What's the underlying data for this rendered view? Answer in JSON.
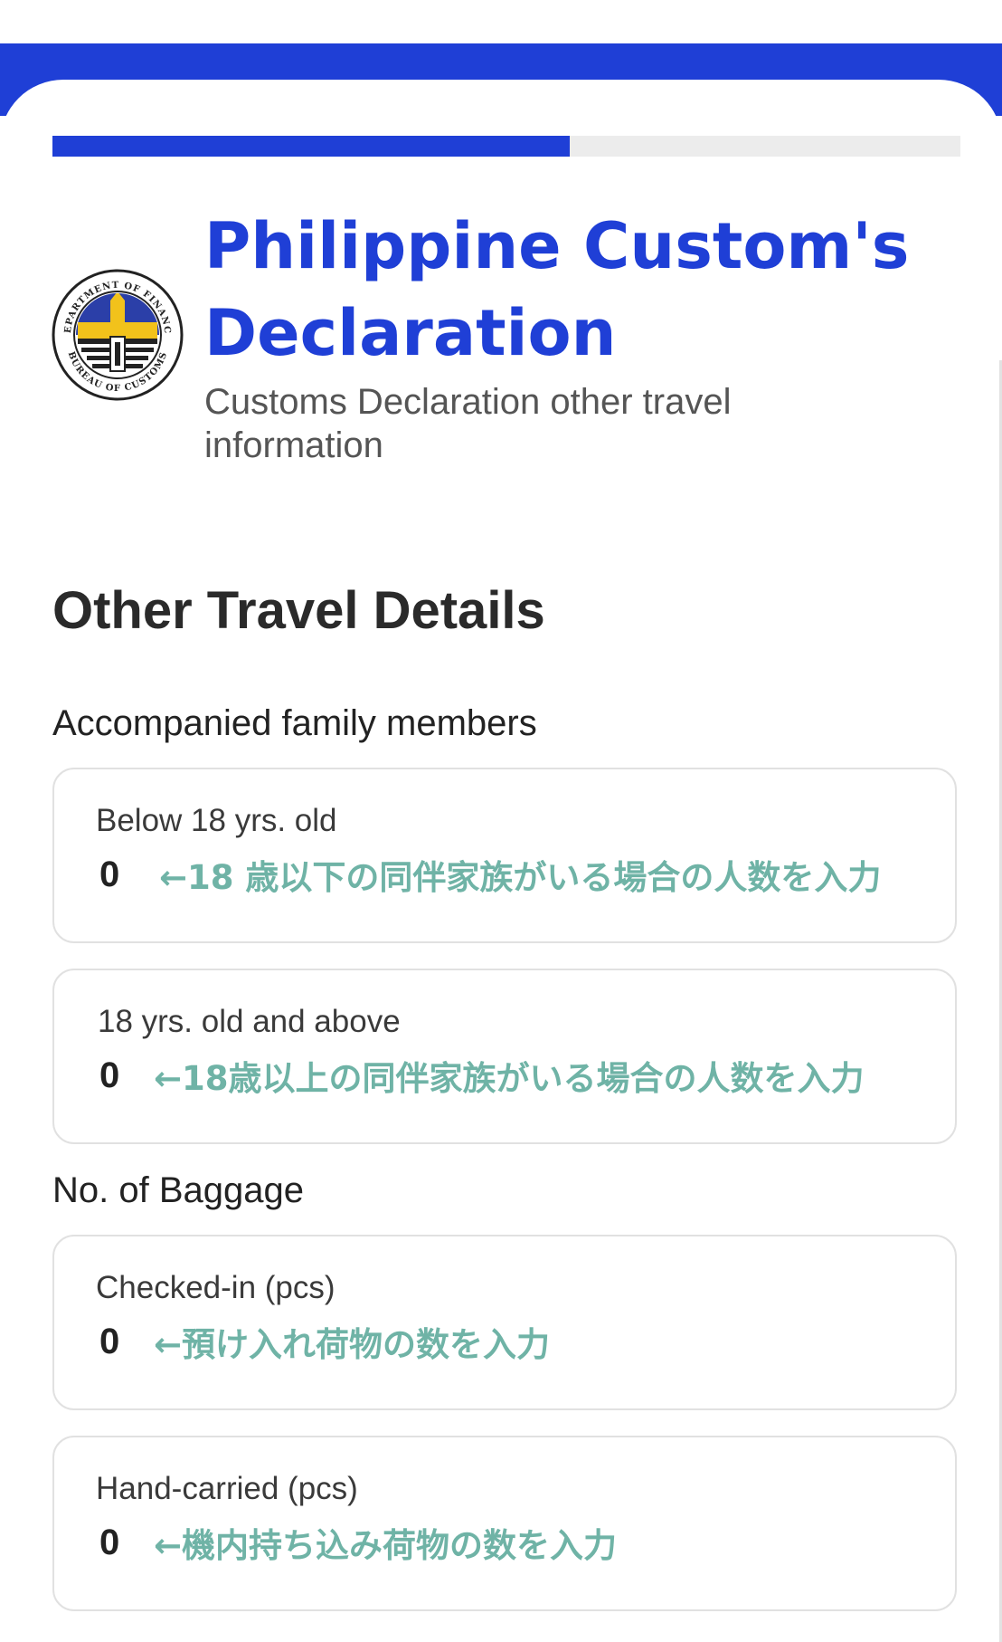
{
  "header": {
    "progress_fraction": 0.57,
    "title": "Philippine Custom's Declaration",
    "subtitle": "Customs Declaration other travel information",
    "logo_icon": "bureau-of-customs-seal",
    "seal_text_top": "DEPARTMENT OF FINANCE",
    "seal_text_bottom": "BUREAU OF CUSTOMS"
  },
  "section": {
    "title": "Other Travel Details"
  },
  "family": {
    "label": "Accompanied family members",
    "below18": {
      "label": "Below 18 yrs. old",
      "value": "0",
      "note": "←18 歳以下の同伴家族がいる場合の人数を入力"
    },
    "above18": {
      "label": "18 yrs. old and above",
      "value": "0",
      "note": "←18歳以上の同伴家族がいる場合の人数を入力"
    }
  },
  "baggage": {
    "label": "No. of Baggage",
    "checked": {
      "label": "Checked-in (pcs)",
      "value": "0",
      "note": "←預け入れ荷物の数を入力"
    },
    "hand": {
      "label": "Hand-carried (pcs)",
      "value": "0",
      "note": "←機内持ち込み荷物の数を入力"
    }
  },
  "colors": {
    "brand_blue": "#1f3fd6",
    "note_teal": "#6fb3a6",
    "track_gray": "#ececec",
    "border_gray": "#e1e1e1"
  }
}
